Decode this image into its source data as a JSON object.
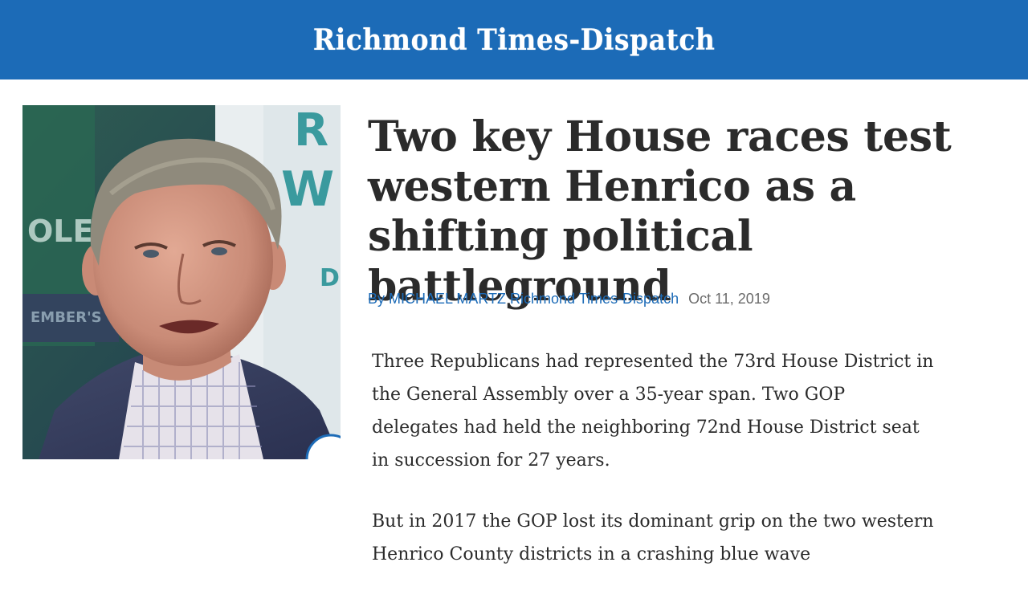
{
  "masthead": {
    "title": "Richmond Times-Dispatch",
    "background_color": "#1c6bb7"
  },
  "photo": {
    "description_icon": "portrait-photo",
    "sign_letters": [
      "R",
      "W",
      "D"
    ],
    "banner_text": "EMBER'S"
  },
  "article": {
    "headline": "Two key House races test western Henrico as a shifting political battleground",
    "byline": "By MICHAEL MARTZ Richmond Times-Dispatch",
    "date": "Oct 11, 2019",
    "paragraphs": [
      "Three Republicans had represented the 73rd House District in the General Assembly over a 35-year span. Two GOP delegates had held the neighboring 72nd House District seat in succession for 27 years.",
      "But in 2017 the GOP lost its dominant grip on the two western Henrico County districts in a crashing blue wave"
    ]
  }
}
